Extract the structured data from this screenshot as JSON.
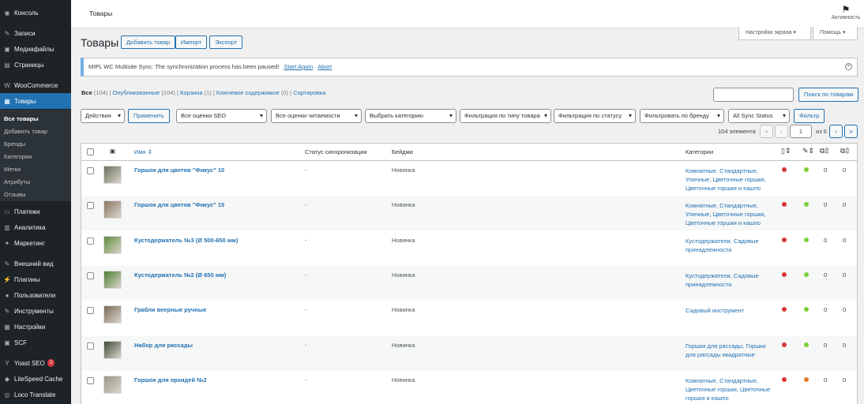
{
  "sidebar": {
    "items": [
      {
        "label": "Консоль",
        "icon": "dashboard-icon"
      },
      {
        "label": "Записи",
        "icon": "pin-icon"
      },
      {
        "label": "Медиафайлы",
        "icon": "media-icon"
      },
      {
        "label": "Страницы",
        "icon": "pages-icon"
      },
      {
        "label": "WooCommerce",
        "icon": "woocommerce-icon"
      },
      {
        "label": "Товары",
        "icon": "products-icon"
      },
      {
        "label": "Платежи",
        "icon": "payments-icon"
      },
      {
        "label": "Аналитика",
        "icon": "analytics-icon"
      },
      {
        "label": "Маркетинг",
        "icon": "marketing-icon"
      },
      {
        "label": "Внешний вид",
        "icon": "appearance-icon"
      },
      {
        "label": "Плагины",
        "icon": "plugins-icon"
      },
      {
        "label": "Пользователи",
        "icon": "users-icon"
      },
      {
        "label": "Инструменты",
        "icon": "tools-icon"
      },
      {
        "label": "Настройки",
        "icon": "settings-icon"
      },
      {
        "label": "SCF",
        "icon": "scf-icon"
      },
      {
        "label": "Yoast SEO",
        "icon": "yoast-icon",
        "badge": "2"
      },
      {
        "label": "LiteSpeed Cache",
        "icon": "litespeed-icon"
      },
      {
        "label": "Loco Translate",
        "icon": "loco-icon"
      }
    ],
    "submenu": [
      "Все товары",
      "Добавить товар",
      "Бренды",
      "Категории",
      "Метки",
      "Атрибуты",
      "Отзывы"
    ]
  },
  "topbar": {
    "page_title": "Товары",
    "activity_label": "Активность"
  },
  "screen_options": "Настройки экрана ▾",
  "help": "Помощь ▾",
  "page": {
    "title": "Товары",
    "add_label": "Добавить товар",
    "import_label": "Импорт",
    "export_label": "Экспорт"
  },
  "notice": {
    "text": "MIPL WC Multisite Sync: The synchronization process has been paused!",
    "retry": "Start Again",
    "abort": "Abort"
  },
  "views": {
    "all": "Все",
    "all_count": "(104)",
    "published": "Опубликованные",
    "published_count": "(104)",
    "trash": "Корзина",
    "trash_count": "(1)",
    "cornerstone": "Ключевое содержимое",
    "cornerstone_count": "(0)",
    "sorting": "Сортировка"
  },
  "search": {
    "button": "Поиск по товарам",
    "value": ""
  },
  "filters": {
    "bulk": "Действия",
    "apply": "Применить",
    "seo": "Все оценки SEO",
    "readability": "Все оценки читаемости",
    "category": "Выбрать категорию",
    "type": "Фильтрация по типу товара",
    "stock": "Фильтрация по статусу",
    "brand": "Фильтровать по бренду",
    "sync": "All Sync Status",
    "filter_button": "Фильтр"
  },
  "pagination": {
    "count": "104 элемента",
    "first": "«",
    "prev": "‹",
    "current": "1",
    "of": "из 6",
    "next": "›",
    "last": "»"
  },
  "columns": {
    "name": "Имя",
    "sync": "Статус синхронизации",
    "badges": "Бейджи",
    "categories": "Категории"
  },
  "rows": [
    {
      "name": "Горшок для цветов \"Фикус\" 10",
      "sync": "-",
      "badge": "Новинка",
      "categories": "Комнатные, Стандартные, Уличные, Цветочные горшки, Цветочные горшки и кашпо",
      "seo": "#d63638",
      "read": "#7ad03a",
      "links_out": "0",
      "links_in": "0",
      "thumb": "#6b6f5a"
    },
    {
      "name": "Горшок для цветов \"Фикус\" 15",
      "sync": "-",
      "badge": "Новинка",
      "categories": "Комнатные, Стандартные, Уличные, Цветочные горшки, Цветочные горшки и кашпо",
      "seo": "#d63638",
      "read": "#7ad03a",
      "links_out": "0",
      "links_in": "0",
      "thumb": "#8a7560"
    },
    {
      "name": "Кустодержатель №3 (Ø 500-650 мм)",
      "sync": "-",
      "badge": "Новинка",
      "categories": "Кустодержатели, Садовые принадлежности",
      "seo": "#d63638",
      "read": "#7ad03a",
      "links_out": "0",
      "links_in": "0",
      "thumb": "#5f8a3c"
    },
    {
      "name": "Кустодержатель №2 (Ø 650 мм)",
      "sync": "-",
      "badge": "Новинка",
      "categories": "Кустодержатели, Садовые принадлежности",
      "seo": "#d63638",
      "read": "#7ad03a",
      "links_out": "0",
      "links_in": "0",
      "thumb": "#4e7d33"
    },
    {
      "name": "Грабли веерные ручные",
      "sync": "-",
      "badge": "Новинка",
      "categories": "Садовый инструмент",
      "seo": "#d63638",
      "read": "#7ad03a",
      "links_out": "0",
      "links_in": "0",
      "thumb": "#7a6a55"
    },
    {
      "name": "Набор для рассады",
      "sync": "-",
      "badge": "Новинка",
      "categories": "Горшки для рассады, Горшки для рассады квадратные",
      "seo": "#d63638",
      "read": "#7ad03a",
      "links_out": "0",
      "links_in": "0",
      "thumb": "#3f4a38"
    },
    {
      "name": "Горшок для орхидей №2",
      "sync": "-",
      "badge": "Новинка",
      "categories": "Комнатные, Стандартные, Цветочные горшки, Цветочные горшки и кашпо",
      "seo": "#d63638",
      "read": "#e57a2e",
      "links_out": "0",
      "links_in": "0",
      "thumb": "#9a9688"
    }
  ]
}
